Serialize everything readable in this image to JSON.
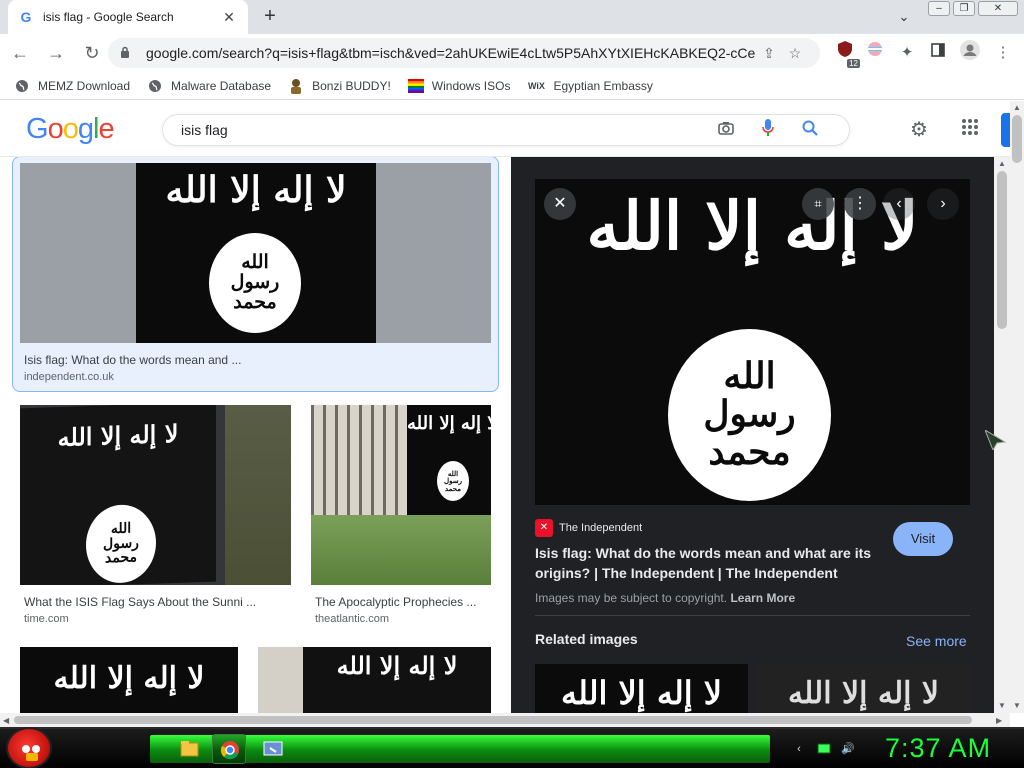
{
  "browser": {
    "tab_title": "isis flag - Google Search",
    "tab_favicon": "G",
    "new_tab_label": "+",
    "url": "google.com/search?q=isis+flag&tbm=isch&ved=2ahUKEwiE4cLtw5P5AhXYtXIEHcKABKEQ2-cCe...",
    "extension_badge": "12"
  },
  "bookmarks": [
    {
      "label": "MEMZ Download",
      "icon": "globe-icon"
    },
    {
      "label": "Malware Database",
      "icon": "globe-icon"
    },
    {
      "label": "Bonzi BUDDY!",
      "icon": "bonzi-icon"
    },
    {
      "label": "Windows ISOs",
      "icon": "windows-icon"
    },
    {
      "label": "Egyptian Embassy",
      "icon": "wix-icon"
    }
  ],
  "bookmark_wix_glyph": "WiX",
  "google": {
    "logo_letters": [
      {
        "ch": "G",
        "color": "#4285f4"
      },
      {
        "ch": "o",
        "color": "#ea4335"
      },
      {
        "ch": "o",
        "color": "#fbbc05"
      },
      {
        "ch": "g",
        "color": "#4285f4"
      },
      {
        "ch": "l",
        "color": "#34a853"
      },
      {
        "ch": "e",
        "color": "#ea4335"
      }
    ],
    "query": "isis flag"
  },
  "flag_text": {
    "top": "لا إله إلا الله",
    "seal_line1": "الله",
    "seal_line2": "رسول",
    "seal_line3": "محمد"
  },
  "results": [
    {
      "caption": "Isis flag: What do the words mean and ...",
      "source": "independent.co.uk"
    },
    {
      "caption": "What the ISIS Flag Says About the Sunni ...",
      "source": "time.com"
    },
    {
      "caption": "The Apocalyptic Prophecies ...",
      "source": "theatlantic.com"
    }
  ],
  "preview": {
    "source_name": "The Independent",
    "source_favicon": "✕",
    "title": "Isis flag: What do the words mean and what are its origins? | The Independent | The Independent",
    "visit_label": "Visit",
    "copyright_prefix": "Images may be subject to copyright.",
    "learn_more": "Learn More",
    "related_heading": "Related images",
    "see_more": "See more"
  },
  "taskbar": {
    "clock": "7:37 AM"
  },
  "colors": {
    "accent_blue": "#1a73e8",
    "panel_bg": "#202124",
    "taskbar_green": "#19ff3a"
  }
}
